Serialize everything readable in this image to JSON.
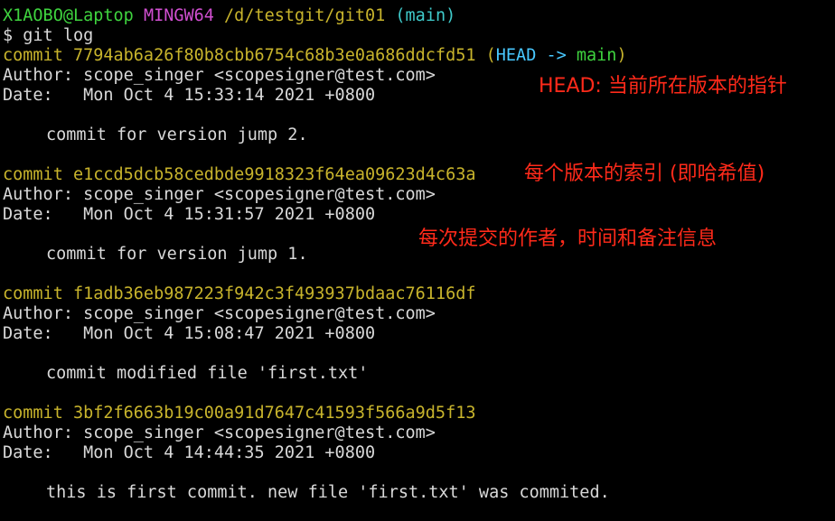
{
  "prompt": {
    "user_host": "X1AOBO@Laptop",
    "shell": "MINGW64",
    "path": "/d/testgit/git01",
    "branch": "(main)",
    "command": "$ git log"
  },
  "commits": [
    {
      "commit_word": "commit",
      "hash": "7794ab6a26f80b8cbb6754c68b3e0a686ddcfd51",
      "ref_open": "(",
      "ref_head": "HEAD -> ",
      "ref_branch": "main",
      "ref_close": ")",
      "author": "Author: scope_singer <scopesigner@test.com>",
      "date": "Date:   Mon Oct 4 15:33:14 2021 +0800",
      "message": "commit for version jump 2."
    },
    {
      "commit_word": "commit",
      "hash": "e1ccd5dcb58cedbde9918323f64ea09623d4c63a",
      "author": "Author: scope_singer <scopesigner@test.com>",
      "date": "Date:   Mon Oct 4 15:31:57 2021 +0800",
      "message": "commit for version jump 1."
    },
    {
      "commit_word": "commit",
      "hash": "f1adb36eb987223f942c3f493937bdaac76116df",
      "author": "Author: scope_singer <scopesigner@test.com>",
      "date": "Date:   Mon Oct 4 15:08:47 2021 +0800",
      "message": "commit modified file 'first.txt'"
    },
    {
      "commit_word": "commit",
      "hash": "3bf2f6663b19c00a91d7647c41593f566a9d5f13",
      "author": "Author: scope_singer <scopesigner@test.com>",
      "date": "Date:   Mon Oct 4 14:44:35 2021 +0800",
      "message": "this is first commit. new file 'first.txt' was commited."
    }
  ],
  "annotations": {
    "head": "HEAD: 当前所在版本的指针",
    "index": "每个版本的索引 (即哈希值)",
    "info": "每次提交的作者，时间和备注信息"
  },
  "colors": {
    "background": "#000000",
    "text": "#d9d9d9",
    "prompt_green": "#3fd43f",
    "prompt_magenta": "#d04fd0",
    "commit_yellow": "#c8b42c",
    "branch_cyan": "#3fcaca",
    "annotation_red": "#ff2a1a"
  }
}
